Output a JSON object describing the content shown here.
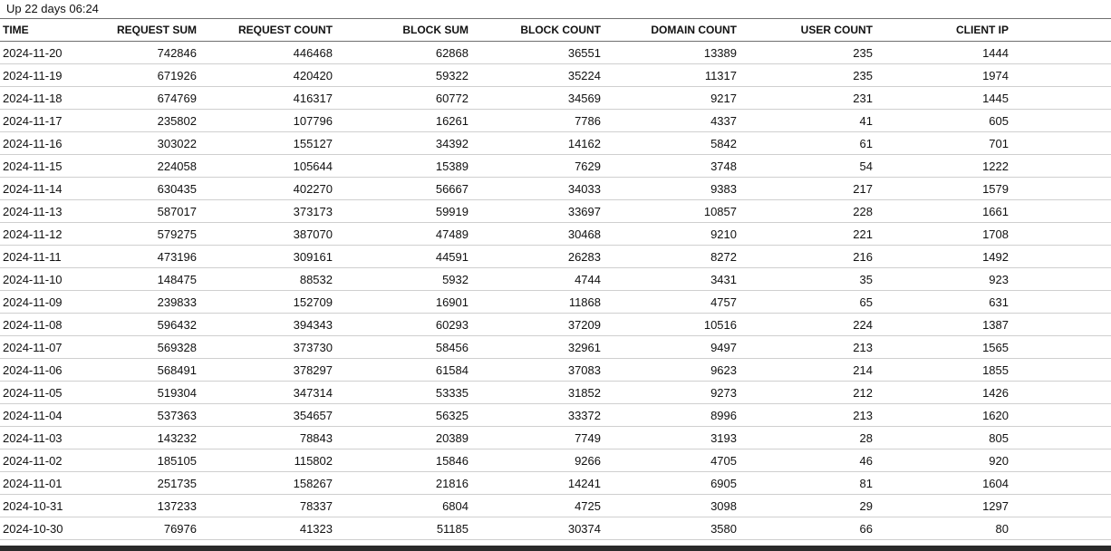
{
  "status": {
    "uptime": "Up 22 days 06:24"
  },
  "table": {
    "columns": [
      "TIME",
      "REQUEST SUM",
      "REQUEST COUNT",
      "BLOCK SUM",
      "BLOCK COUNT",
      "DOMAIN COUNT",
      "USER COUNT",
      "CLIENT IP"
    ],
    "rows": [
      [
        "2024-11-20",
        "742846",
        "446468",
        "62868",
        "36551",
        "13389",
        "235",
        "1444"
      ],
      [
        "2024-11-19",
        "671926",
        "420420",
        "59322",
        "35224",
        "11317",
        "235",
        "1974"
      ],
      [
        "2024-11-18",
        "674769",
        "416317",
        "60772",
        "34569",
        "9217",
        "231",
        "1445"
      ],
      [
        "2024-11-17",
        "235802",
        "107796",
        "16261",
        "7786",
        "4337",
        "41",
        "605"
      ],
      [
        "2024-11-16",
        "303022",
        "155127",
        "34392",
        "14162",
        "5842",
        "61",
        "701"
      ],
      [
        "2024-11-15",
        "224058",
        "105644",
        "15389",
        "7629",
        "3748",
        "54",
        "1222"
      ],
      [
        "2024-11-14",
        "630435",
        "402270",
        "56667",
        "34033",
        "9383",
        "217",
        "1579"
      ],
      [
        "2024-11-13",
        "587017",
        "373173",
        "59919",
        "33697",
        "10857",
        "228",
        "1661"
      ],
      [
        "2024-11-12",
        "579275",
        "387070",
        "47489",
        "30468",
        "9210",
        "221",
        "1708"
      ],
      [
        "2024-11-11",
        "473196",
        "309161",
        "44591",
        "26283",
        "8272",
        "216",
        "1492"
      ],
      [
        "2024-11-10",
        "148475",
        "88532",
        "5932",
        "4744",
        "3431",
        "35",
        "923"
      ],
      [
        "2024-11-09",
        "239833",
        "152709",
        "16901",
        "11868",
        "4757",
        "65",
        "631"
      ],
      [
        "2024-11-08",
        "596432",
        "394343",
        "60293",
        "37209",
        "10516",
        "224",
        "1387"
      ],
      [
        "2024-11-07",
        "569328",
        "373730",
        "58456",
        "32961",
        "9497",
        "213",
        "1565"
      ],
      [
        "2024-11-06",
        "568491",
        "378297",
        "61584",
        "37083",
        "9623",
        "214",
        "1855"
      ],
      [
        "2024-11-05",
        "519304",
        "347314",
        "53335",
        "31852",
        "9273",
        "212",
        "1426"
      ],
      [
        "2024-11-04",
        "537363",
        "354657",
        "56325",
        "33372",
        "8996",
        "213",
        "1620"
      ],
      [
        "2024-11-03",
        "143232",
        "78843",
        "20389",
        "7749",
        "3193",
        "28",
        "805"
      ],
      [
        "2024-11-02",
        "185105",
        "115802",
        "15846",
        "9266",
        "4705",
        "46",
        "920"
      ],
      [
        "2024-11-01",
        "251735",
        "158267",
        "21816",
        "14241",
        "6905",
        "81",
        "1604"
      ],
      [
        "2024-10-31",
        "137233",
        "78337",
        "6804",
        "4725",
        "3098",
        "29",
        "1297"
      ],
      [
        "2024-10-30",
        "76976",
        "41323",
        "51185",
        "30374",
        "3580",
        "66",
        "80"
      ]
    ]
  }
}
